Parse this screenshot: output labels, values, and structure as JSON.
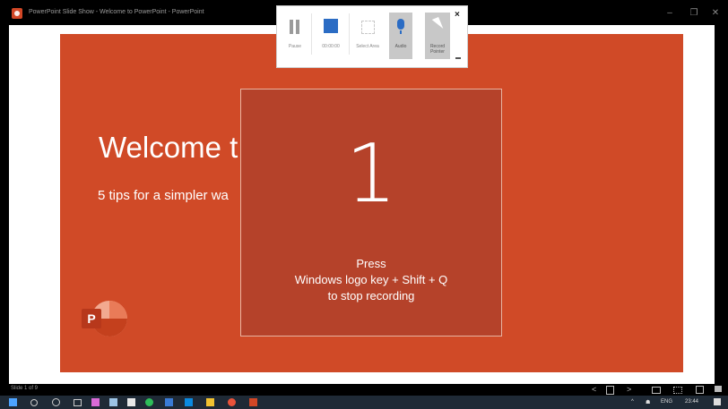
{
  "window": {
    "title": "PowerPoint Slide Show - Welcome to PowerPoint - PowerPoint",
    "minimize_glyph": "–",
    "restore_glyph": "❐",
    "close_glyph": "✕"
  },
  "slide": {
    "title": "Welcome t",
    "subtitle": "5 tips for a simpler wa",
    "logo_letter": "P"
  },
  "recording_toolbar": {
    "pause_label": "Pause",
    "timer": "00:00:00",
    "select_area_label": "Select Area",
    "audio_label": "Audio",
    "record_pointer_label": "Record Pointer",
    "close_glyph": "×"
  },
  "countdown": {
    "number": "1",
    "line1": "Press",
    "line2": "Windows logo key + Shift + Q",
    "line3": "to stop recording"
  },
  "status_bar": {
    "slide_counter": "Slide 1 of 9",
    "prev_glyph": "<",
    "next_glyph": ">"
  },
  "taskbar": {
    "language": "ENG",
    "time": "23:44"
  },
  "colors": {
    "slide_bg": "#d04a27",
    "countdown_bg": "#b5422a",
    "accent_blue": "#2b6cc4"
  }
}
